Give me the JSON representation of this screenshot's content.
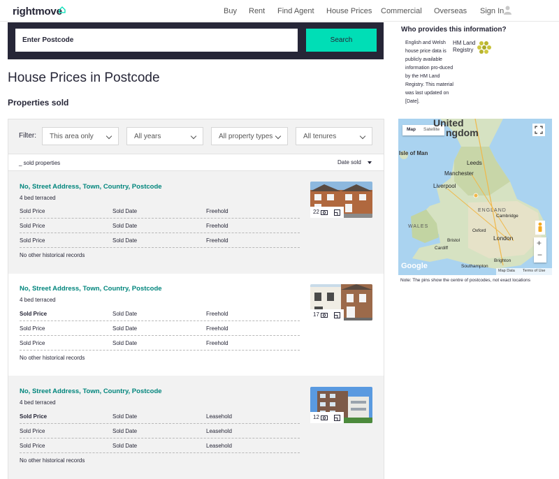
{
  "header": {
    "logo": "rightmove",
    "nav": [
      "Buy",
      "Rent",
      "Find Agent",
      "House Prices",
      "Commercial",
      "Overseas"
    ],
    "sign_in": "Sign In"
  },
  "search": {
    "value": "Enter Postcode",
    "button": "Search"
  },
  "page_title": "House Prices in Postcode",
  "section_title": "Properties sold",
  "filters": {
    "label": "Filter:",
    "area": "This area only",
    "years": "All years",
    "types": "All property types",
    "tenures": "All tenures"
  },
  "results": {
    "count_text": "_  sold properties",
    "sort": "Date sold"
  },
  "properties": [
    {
      "address": "No, Street Address, Town, Country, Postcode",
      "beds": "4 bed terraced",
      "photos": "22",
      "rows": [
        {
          "price": "Sold Price",
          "date": "Sold Date",
          "tenure": "Freehold"
        },
        {
          "price": "Sold Price",
          "date": "Sold Date",
          "tenure": "Freehold"
        },
        {
          "price": "Sold Price",
          "date": "Sold Date",
          "tenure": "Freehold"
        }
      ],
      "no_history": "No other historical records"
    },
    {
      "address": "No, Street Address, Town, Country, Postcode",
      "beds": "4 bed terraced",
      "photos": "17",
      "rows": [
        {
          "price": "Sold Price",
          "date": "Sold Date",
          "tenure": "Freehold"
        },
        {
          "price": "Sold Price",
          "date": "Sold Date",
          "tenure": "Freehold"
        },
        {
          "price": "Sold Price",
          "date": "Sold Date",
          "tenure": "Freehold"
        }
      ],
      "no_history": "No other historical records"
    },
    {
      "address": "No, Street Address, Town, Country, Postcode",
      "beds": "4 bed terraced",
      "photos": "12",
      "rows": [
        {
          "price": "Sold Price",
          "date": "Sold Date",
          "tenure": "Leasehold"
        },
        {
          "price": "Sold Price",
          "date": "Sold Date",
          "tenure": "Leasehold"
        },
        {
          "price": "Sold Price",
          "date": "Sold Date",
          "tenure": "Leasehold"
        }
      ],
      "no_history": "No other historical records"
    }
  ],
  "info": {
    "title": "Who provides this information?",
    "text": "English and Welsh house price data is publicly available information pro-duced by the HM Land Registry. This material was last updated on [Date].",
    "hm_label": "HM Land Registry"
  },
  "map": {
    "tab_map": "Map",
    "tab_satellite": "Satellite",
    "labels": {
      "united": "United",
      "kingdom": "ngdom",
      "isle_of_man": "Isle of Man",
      "leeds": "Leeds",
      "manchester": "Manchester",
      "liverpool": "Liverpool",
      "england": "ENGLAND",
      "wales": "WALES",
      "cambridge": "Cambridge",
      "oxford": "Oxford",
      "bristol": "Bristol",
      "cardiff": "Cardiff",
      "london": "London",
      "southampton": "Southampton",
      "brighton": "Brighton"
    },
    "google": "Google",
    "map_data": "Map Data",
    "terms": "Terms of Use",
    "note": "Note: The pins show the centre of postcodes, not exact locations"
  },
  "colors": {
    "brand_dark": "#262637",
    "accent": "#00deb6",
    "link": "#00857c"
  }
}
